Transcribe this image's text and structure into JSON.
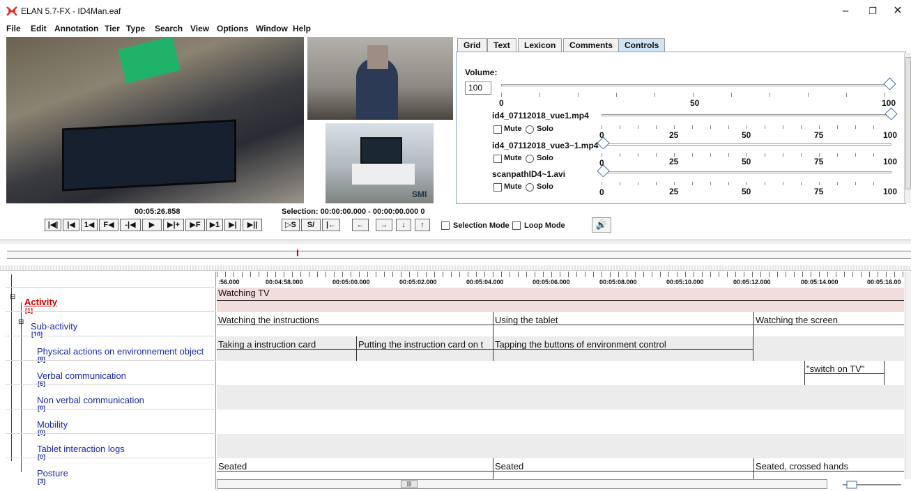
{
  "window": {
    "title": "ELAN 5.7-FX - ID4Man.eaf",
    "minimize": "–",
    "maximize": "❐",
    "close": "✕"
  },
  "menu": [
    "File",
    "Edit",
    "Annotation",
    "Tier",
    "Type",
    "Search",
    "View",
    "Options",
    "Window",
    "Help"
  ],
  "video": {
    "logo_text": "SMI"
  },
  "tabs": [
    "Grid",
    "Text",
    "Lexicon",
    "Comments",
    "Controls"
  ],
  "active_tab": "Controls",
  "controls": {
    "volume_label": "Volume:",
    "volume_value": "100",
    "master_slider": {
      "value": 100,
      "scale": [
        "0",
        "50",
        "100"
      ]
    },
    "tracks": [
      {
        "name": "id4_07112018_vue1.mp4",
        "mute": "Mute",
        "solo": "Solo",
        "value": 100,
        "scale": [
          "0",
          "25",
          "50",
          "75",
          "100"
        ]
      },
      {
        "name": "id4_07112018_vue3~1.mp4",
        "mute": "Mute",
        "solo": "Solo",
        "value": 0,
        "scale": [
          "0",
          "25",
          "50",
          "75",
          "100"
        ]
      },
      {
        "name": "scanpathID4~1.avi",
        "mute": "Mute",
        "solo": "Solo",
        "value": 0,
        "scale": [
          "0",
          "25",
          "50",
          "75",
          "100"
        ]
      }
    ]
  },
  "transport": {
    "time": "00:05:26.858",
    "selection": "Selection: 00:00:00.000 - 00:00:00.000  0",
    "buttons_left": [
      "|◀|",
      "|◀",
      "1◀",
      "F◀",
      "-|◀",
      "▶",
      "▶|+",
      "▶F",
      "▶1",
      "▶|",
      "▶||"
    ],
    "buttons_mid": [
      "▷S",
      "S/",
      "|←"
    ],
    "buttons_nav": [
      "←",
      "→",
      "↓",
      "↑"
    ],
    "selection_mode": "Selection Mode",
    "loop_mode": "Loop Mode",
    "speaker_icon": "🔊"
  },
  "ruler": [
    ":56.000",
    "00:04:58.000",
    "00:05:00.000",
    "00:05:02.000",
    "00:05:04.000",
    "00:05:06.000",
    "00:05:08.000",
    "00:05:10.000",
    "00:05:12.000",
    "00:05:14.000",
    "00:05:16.00"
  ],
  "tiers": [
    {
      "name": "Activity",
      "count": "[1]",
      "annotations": [
        {
          "text": "Watching TV"
        }
      ]
    },
    {
      "name": "Sub-activity",
      "count": "[10]",
      "annotations": [
        {
          "text": "Watching the instructions"
        },
        {
          "text": "Using the tablet"
        },
        {
          "text": "Watching the screen"
        }
      ]
    },
    {
      "name": "Physical actions on environnement object",
      "count": "[8]",
      "annotations": [
        {
          "text": "Taking a instruction card"
        },
        {
          "text": "Putting the instruction card on t"
        },
        {
          "text": "Tapping the buttons of environment control"
        }
      ]
    },
    {
      "name": "Verbal communication",
      "count": "[6]",
      "annotations": [
        {
          "text": "\"switch on TV\""
        }
      ]
    },
    {
      "name": "Non verbal communication",
      "count": "[0]",
      "annotations": []
    },
    {
      "name": "Mobility",
      "count": "[0]",
      "annotations": []
    },
    {
      "name": "Tablet interaction logs",
      "count": "[0]",
      "annotations": []
    },
    {
      "name": "Posture",
      "count": "[3]",
      "annotations": [
        {
          "text": "Seated"
        },
        {
          "text": "Seated"
        },
        {
          "text": "Seated, crossed hands"
        }
      ]
    }
  ],
  "colors": {
    "active_tier": "#cc0000",
    "tier_label": "#1a29a8",
    "activity_band": "#f3dcdc",
    "alt_band": "#ececec",
    "tab_active": "#cfe3f7",
    "panel_border": "#7ca3d6"
  }
}
